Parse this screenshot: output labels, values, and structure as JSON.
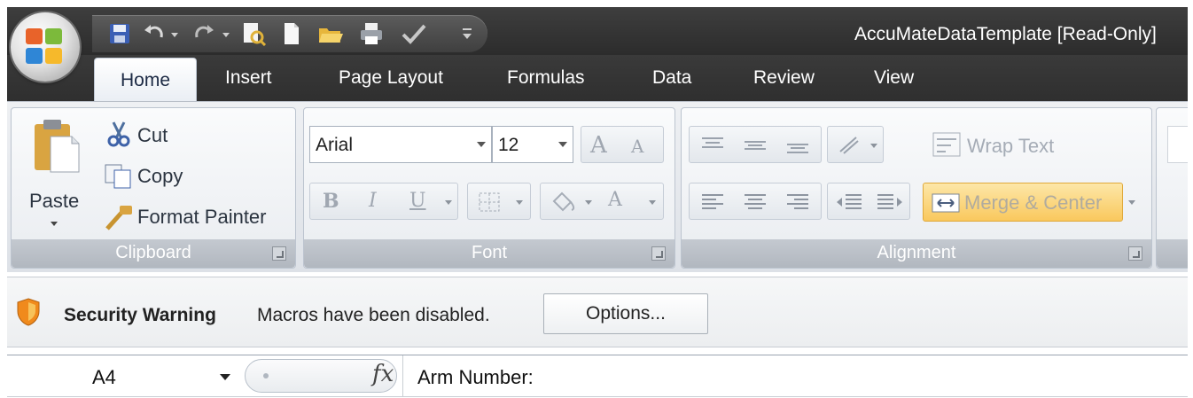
{
  "window": {
    "title": "AccuMateDataTemplate  [Read-Only]"
  },
  "quick_access": {
    "icons": [
      "save-icon",
      "undo-icon",
      "redo-icon",
      "print-preview-icon",
      "new-icon",
      "open-icon",
      "quick-print-icon",
      "spelling-icon",
      "customize-icon"
    ]
  },
  "tabs": [
    {
      "label": "Home",
      "active": true
    },
    {
      "label": "Insert"
    },
    {
      "label": "Page Layout"
    },
    {
      "label": "Formulas"
    },
    {
      "label": "Data"
    },
    {
      "label": "Review"
    },
    {
      "label": "View"
    }
  ],
  "clipboard": {
    "caption": "Clipboard",
    "paste_label": "Paste",
    "cut_label": "Cut",
    "copy_label": "Copy",
    "format_painter_label": "Format Painter"
  },
  "font": {
    "caption": "Font",
    "font_name": "Arial",
    "font_size": "12",
    "bold": "B",
    "italic": "I",
    "underline": "U",
    "font_color_glyph": "A",
    "grow_glyph": "A",
    "shrink_glyph": "A"
  },
  "alignment": {
    "caption": "Alignment",
    "wrap_text_label": "Wrap Text",
    "merge_center_label": "Merge & Center"
  },
  "security": {
    "title": "Security Warning",
    "message": "Macros have been disabled.",
    "options_label": "Options..."
  },
  "formula_bar": {
    "name_box": "A4",
    "fx_label": "fx",
    "content": "Arm Number:"
  },
  "colors": {
    "accent_highlight": "#f9c85d",
    "title_bar": "#2f2f2f"
  }
}
